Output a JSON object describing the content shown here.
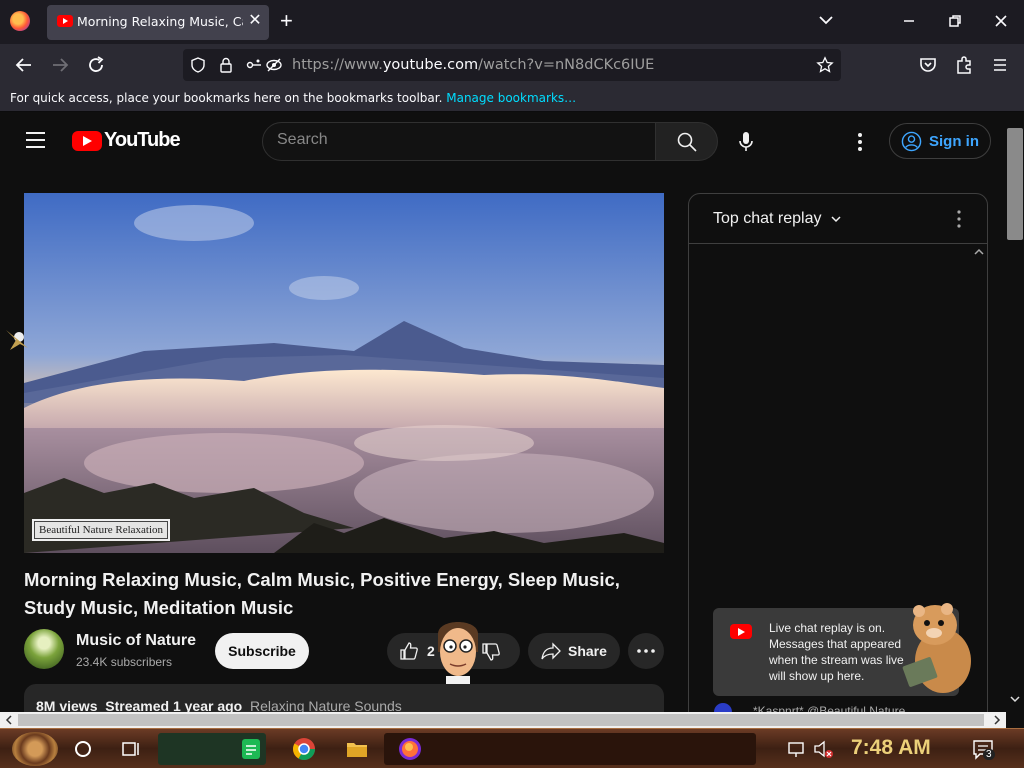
{
  "browser": {
    "tab_title": "Morning Relaxing Music, Calm",
    "tab_close": "✕",
    "new_tab": "+",
    "url_prefix": "https://www.",
    "url_domain": "youtube.com",
    "url_path": "/watch?v=nN8dCKc6IUE",
    "bookmarks_text": "For quick access, place your bookmarks here on the bookmarks toolbar.",
    "bookmarks_link": "Manage bookmarks…"
  },
  "header": {
    "logo_text": "YouTube",
    "search_placeholder": "Search",
    "sign_in": "Sign in"
  },
  "video": {
    "watermark": "Beautiful Nature Relaxation",
    "title": "Morning Relaxing Music, Calm Music, Positive Energy, Sleep Music, Study Music, Meditation Music",
    "channel": "Music of Nature",
    "subscribers": "23.4K subscribers",
    "subscribe": "Subscribe",
    "likes": "2",
    "share": "Share",
    "views": "8M views",
    "streamed": "Streamed 1 year ago",
    "tag": "Relaxing Nature Sounds"
  },
  "chat": {
    "title": "Top chat replay",
    "notice": "Live chat replay is on. Messages that appeared when the stream was live will show up here.",
    "author_preview": "*Kaspnrt* @Beautiful Nature"
  },
  "taskbar": {
    "clock": "7:48 AM",
    "notifications": "3"
  },
  "colors": {
    "youtube_red": "#ff0000",
    "link_blue": "#3ea6ff",
    "clock_gold": "#ecd079"
  }
}
